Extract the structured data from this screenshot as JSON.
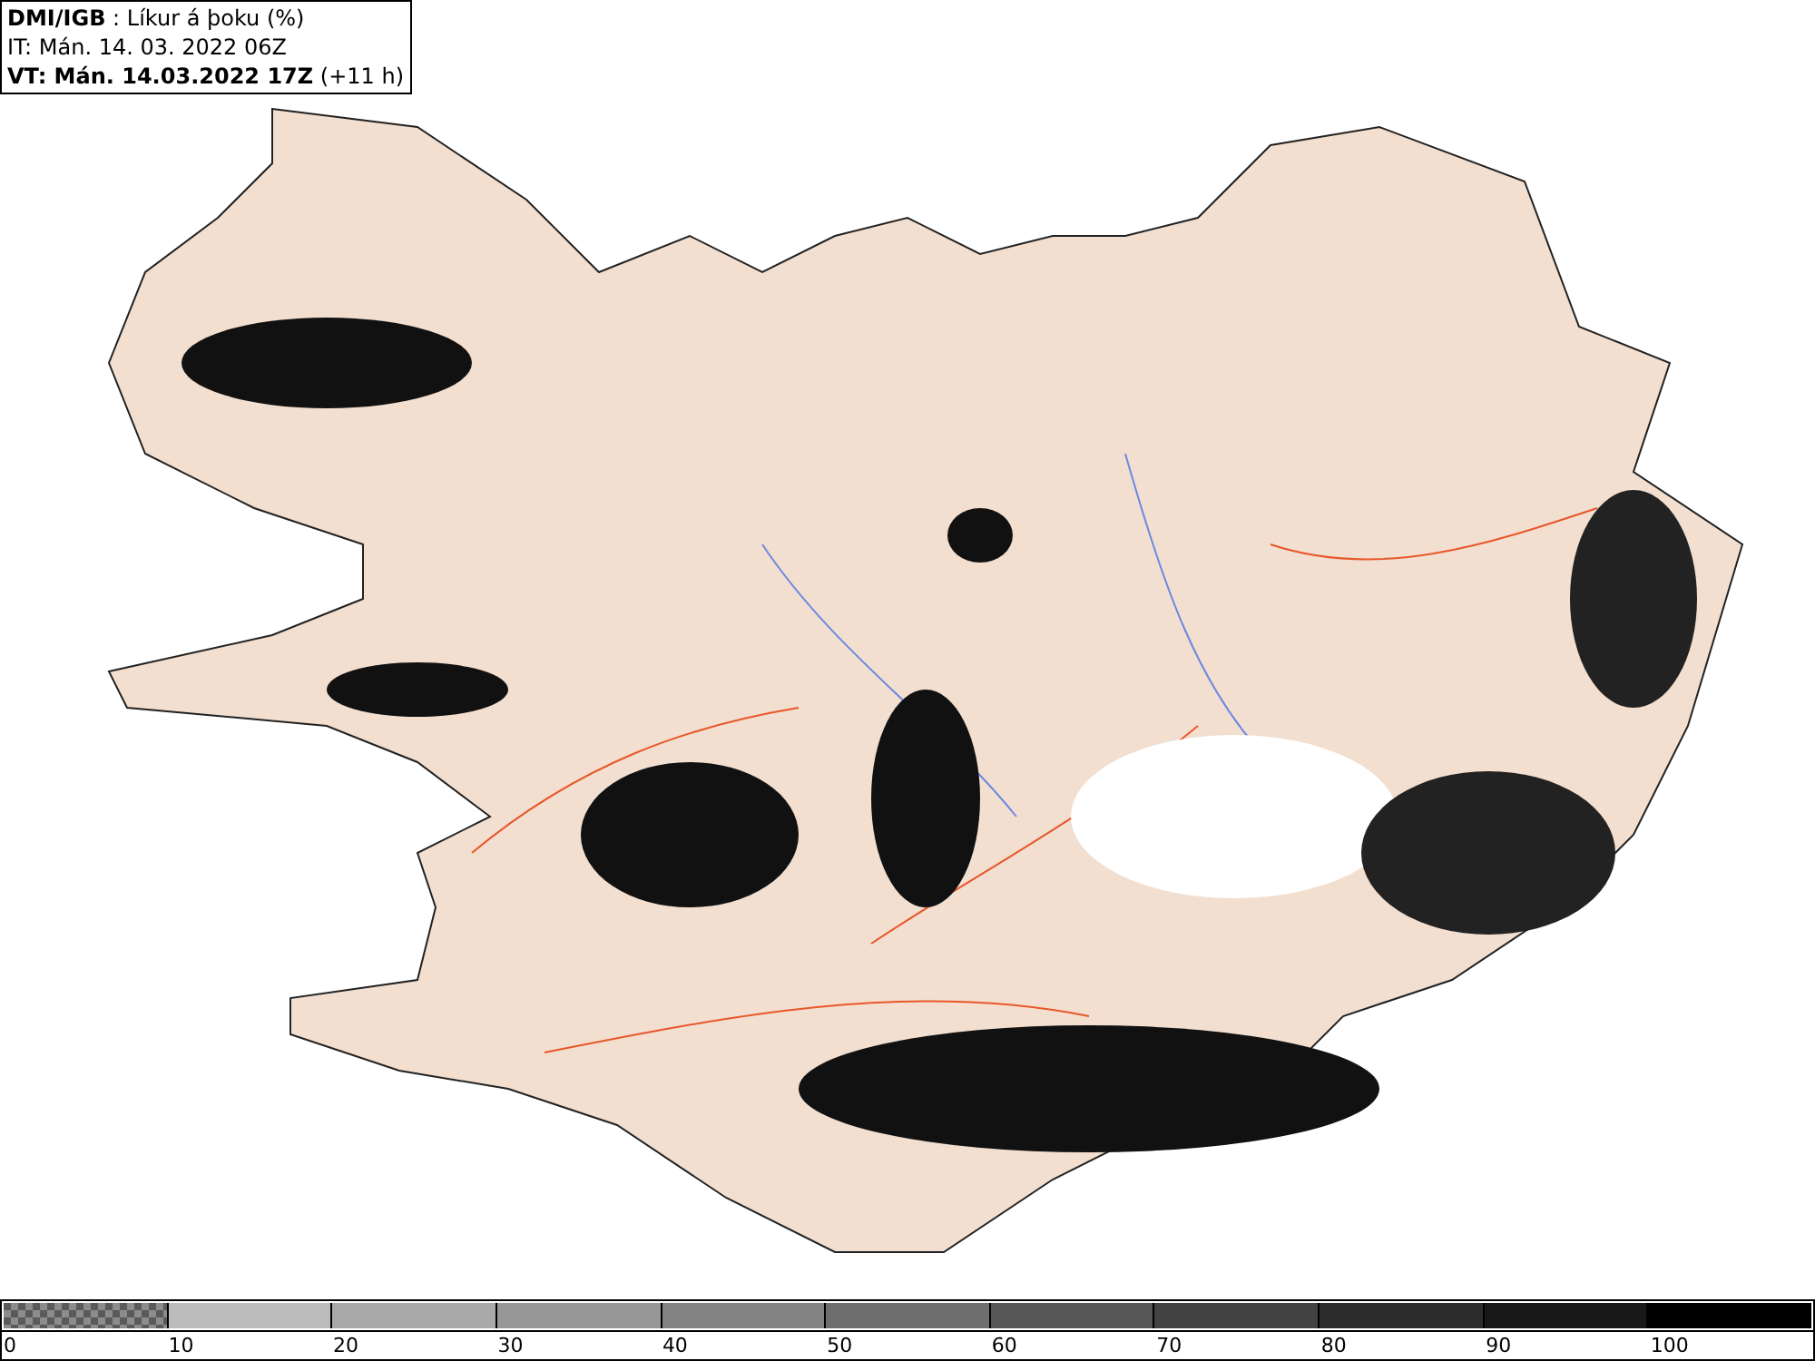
{
  "legend": {
    "lines": [
      "**DMI/IGB** : Líkur á þoku (%)",
      "IT: Mán. 14. 03. 2022 06Z",
      "**VT: Mán. 14.03.2022 17Z** (+11 h)"
    ]
  },
  "color_scale": {
    "segments": [
      {
        "label": "0",
        "kind": "checker",
        "color": "#8c8c8c"
      },
      {
        "label": "10",
        "kind": "solid",
        "color": "#bcbcbc"
      },
      {
        "label": "20",
        "kind": "solid",
        "color": "#a9a9a9"
      },
      {
        "label": "30",
        "kind": "solid",
        "color": "#979797"
      },
      {
        "label": "40",
        "kind": "solid",
        "color": "#838383"
      },
      {
        "label": "50",
        "kind": "solid",
        "color": "#6e6e6e"
      },
      {
        "label": "60",
        "kind": "solid",
        "color": "#585858"
      },
      {
        "label": "70",
        "kind": "solid",
        "color": "#424242"
      },
      {
        "label": "80",
        "kind": "solid",
        "color": "#2c2c2c"
      },
      {
        "label": "90",
        "kind": "solid",
        "color": "#181818"
      },
      {
        "label": "100",
        "kind": "solid",
        "color": "#000000"
      }
    ]
  }
}
